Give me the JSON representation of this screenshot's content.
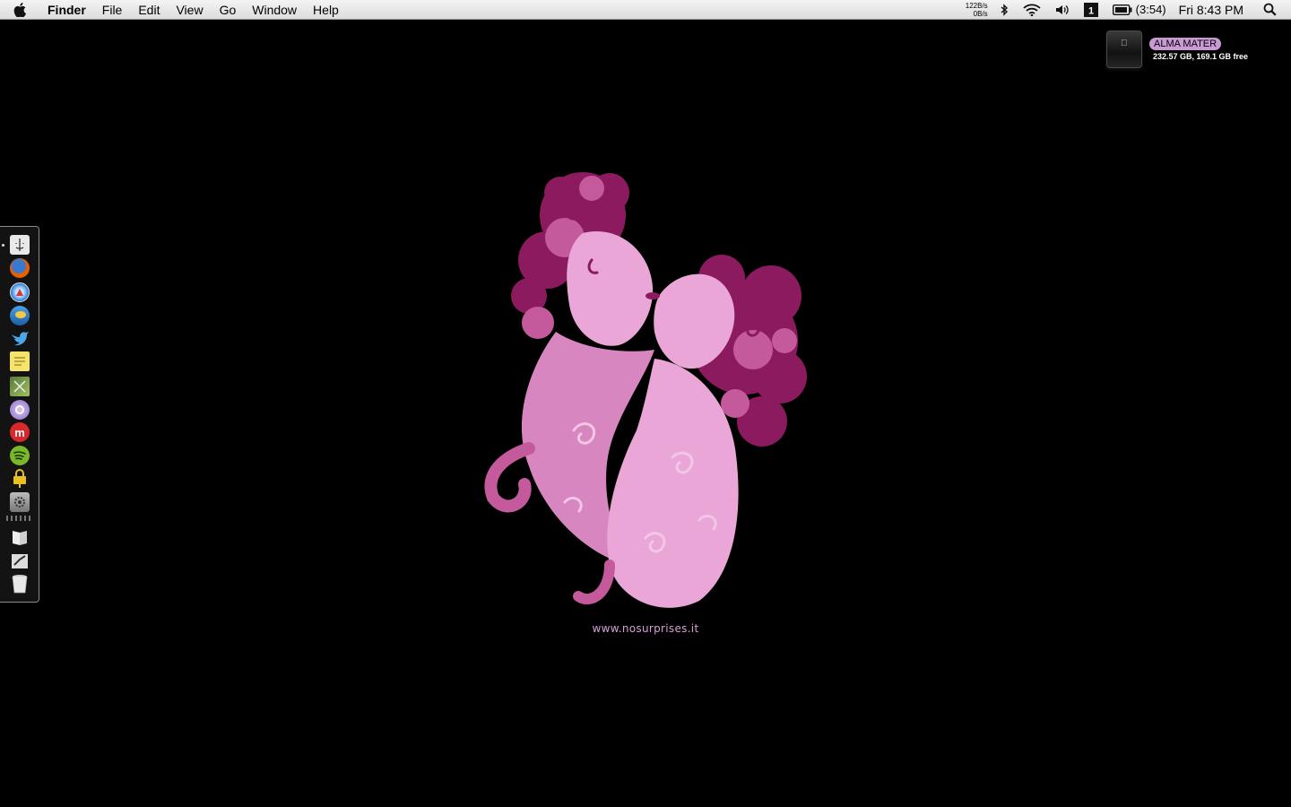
{
  "menubar": {
    "app_name": "Finder",
    "menus": [
      "File",
      "Edit",
      "View",
      "Go",
      "Window",
      "Help"
    ],
    "network_up": "122B/s",
    "network_down": "0B/s",
    "battery_time": "(3:54)",
    "clock": "Fri 8:43 PM",
    "icons": [
      "apple-icon",
      "bluetooth-icon",
      "wifi-icon",
      "volume-icon",
      "spaces-icon",
      "battery-icon",
      "spotlight-icon"
    ]
  },
  "drive": {
    "name": "ALMA MATER",
    "space": "232.57 GB, 169.1 GB free",
    "label_color": "#c99ad3"
  },
  "wallpaper": {
    "credit": "www.nosurprises.it",
    "background_color": "#000000",
    "art_colors": [
      "#e9a6d6",
      "#c45a9c",
      "#8c1a5e",
      "#f2c6e6"
    ]
  },
  "dock": {
    "items": [
      {
        "name": "finder",
        "icon": "finder-icon",
        "running": true
      },
      {
        "name": "firefox",
        "icon": "firefox-icon",
        "running": false
      },
      {
        "name": "safari",
        "icon": "safari-icon",
        "running": false
      },
      {
        "name": "adium",
        "icon": "adium-icon",
        "running": false
      },
      {
        "name": "twitter",
        "icon": "twitter-bird-icon",
        "running": false
      },
      {
        "name": "stickies",
        "icon": "stickies-icon",
        "running": false
      },
      {
        "name": "preview",
        "icon": "image-editor-icon",
        "running": false
      },
      {
        "name": "messenger",
        "icon": "messenger-icon",
        "running": false
      },
      {
        "name": "miro",
        "icon": "miro-icon",
        "running": false
      },
      {
        "name": "spotify",
        "icon": "spotify-icon",
        "running": false
      },
      {
        "name": "vpn",
        "icon": "lock-icon",
        "running": false
      },
      {
        "name": "system-preferences",
        "icon": "system-preferences-icon",
        "running": false
      },
      {
        "name": "documents",
        "icon": "documents-stack-icon",
        "running": false
      },
      {
        "name": "downloads",
        "icon": "downloads-stack-icon",
        "running": false
      },
      {
        "name": "trash",
        "icon": "trash-icon",
        "running": false
      }
    ]
  }
}
